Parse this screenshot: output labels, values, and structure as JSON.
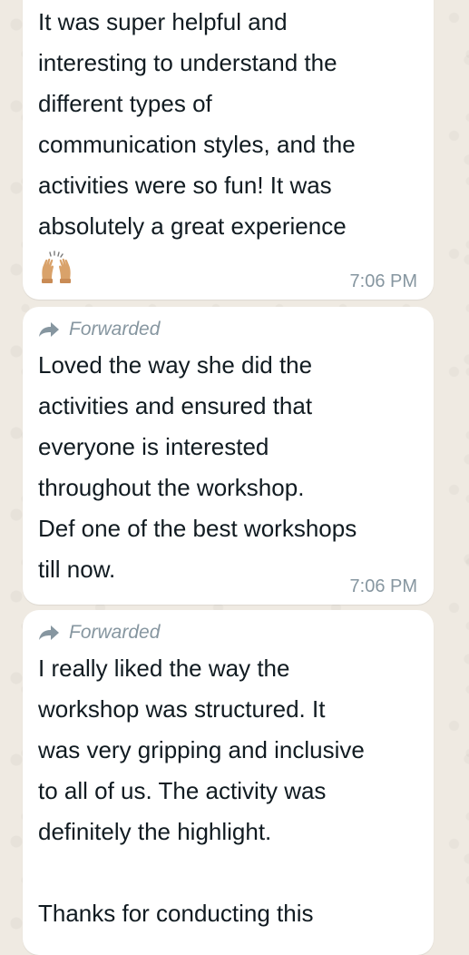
{
  "messages": [
    {
      "forwarded": false,
      "text": "It was super helpful and\ninteresting to understand the\ndifferent types of\ncommunication styles, and the\nactivities were so fun! It was\nabsolutely a great experience",
      "emoji": "raising-hands-emoji",
      "time": "7:06 PM"
    },
    {
      "forwarded": true,
      "forwarded_label": "Forwarded",
      "text": "Loved the way she did the\nactivities and ensured that\neveryone is interested\nthroughout the workshop.\nDef one of the best workshops\ntill now.",
      "time": "7:06 PM"
    },
    {
      "forwarded": true,
      "forwarded_label": "Forwarded",
      "text": "I really liked the way the\nworkshop was structured. It\nwas very gripping and inclusive\nto all of us. The activity was\ndefinitely the highlight.\n\nThanks for conducting this"
    }
  ],
  "colors": {
    "chat_background": "#efeae2",
    "bubble": "#ffffff",
    "meta_text": "#8696a0",
    "message_text": "#111b21"
  },
  "icons": [
    "forward-arrow-icon",
    "raising-hands-emoji"
  ]
}
